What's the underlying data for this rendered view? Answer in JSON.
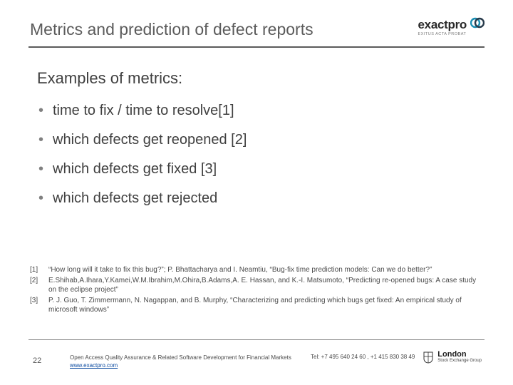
{
  "header": {
    "title": "Metrics and prediction of defect reports",
    "logo": {
      "word": "exactpro",
      "tagline": "EXITUS ACTA PROBAT"
    }
  },
  "subtitle": "Examples of metrics:",
  "bullets": [
    "time to fix / time to resolve[1]",
    "which defects get reopened [2]",
    "which defects get fixed [3]",
    "which defects get rejected"
  ],
  "refs": [
    {
      "n": "[1]",
      "t": "“How long will it take to fix this bug?”;  P. Bhattacharya and I. Neamtiu, “Bug-fix time prediction models: Can we do better?”"
    },
    {
      "n": "[2]",
      "t": " E.Shihab,A.Ihara,Y.Kamei,W.M.Ibrahim,M.Ohira,B.Adams,A. E. Hassan, and K.-I. Matsumoto, “Predicting re-opened bugs: A case study on the eclipse project”"
    },
    {
      "n": "[3]",
      "t": "  P. J. Guo, T. Zimmermann, N. Nagappan, and B. Murphy, “Characterizing and predicting which bugs get fixed: An empirical study of microsoft windows”"
    }
  ],
  "footer": {
    "page": "22",
    "line1": "Open Access Quality Assurance & Related Software Development for Financial Markets",
    "url": "www.exactpro.com",
    "tel": "Tel: +7 495 640 24 60 ,  +1 415 830 38 49",
    "lseg": {
      "name": "London",
      "sub": "Stock Exchange Group"
    }
  }
}
